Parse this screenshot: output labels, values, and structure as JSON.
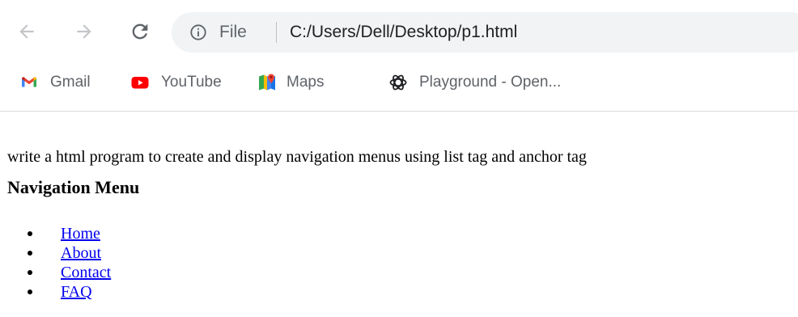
{
  "browser": {
    "address_bar": {
      "scheme_label": "File",
      "url": "C:/Users/Dell/Desktop/p1.html"
    },
    "icons": {
      "back": "arrow-left-icon",
      "forward": "arrow-right-icon",
      "reload": "reload-icon",
      "info": "info-icon"
    },
    "bookmarks": [
      {
        "label": "Gmail",
        "icon": "gmail-icon"
      },
      {
        "label": "YouTube",
        "icon": "youtube-icon"
      },
      {
        "label": "Maps",
        "icon": "maps-icon"
      },
      {
        "label": "Playground - Open...",
        "icon": "openai-icon"
      }
    ]
  },
  "page": {
    "intro_text": "write a html program to create and display navigation menus using list tag and anchor tag",
    "heading": "Navigation Menu",
    "menu_items": [
      {
        "label": "Home"
      },
      {
        "label": "About"
      },
      {
        "label": "Contact"
      },
      {
        "label": "FAQ"
      }
    ]
  },
  "colors": {
    "link": "#0000ee",
    "chrome_text": "#5f6368",
    "omnibox_bg": "#f1f3f4"
  }
}
